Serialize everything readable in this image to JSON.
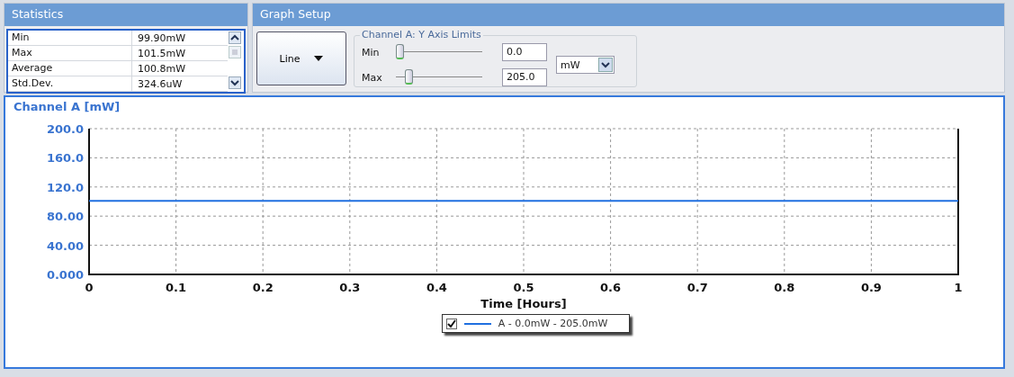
{
  "statistics": {
    "title": "Statistics",
    "rows": [
      {
        "label": "Min",
        "value": "99.90mW"
      },
      {
        "label": "Max",
        "value": "101.5mW"
      },
      {
        "label": "Average",
        "value": "100.8mW"
      },
      {
        "label": "Std.Dev.",
        "value": "324.6uW"
      }
    ]
  },
  "graph_setup": {
    "title": "Graph Setup",
    "type_button": "Line",
    "group_title": "Channel A: Y Axis Limits",
    "limits": [
      {
        "label": "Min",
        "level": 0.0,
        "value": "0.0"
      },
      {
        "label": "Max",
        "level": 0.12,
        "value": "205.0"
      }
    ],
    "unit": "mW"
  },
  "chart": {
    "title": "Channel A [mW]",
    "chart_data": {
      "type": "line",
      "xlabel": "Time [Hours]",
      "x": [
        0,
        1
      ],
      "series": [
        {
          "name": "A - 0.0mW - 205.0mW",
          "color": "#1f6fe0",
          "values": [
            101,
            101
          ]
        }
      ],
      "grid": true,
      "xlim": [
        0,
        1
      ],
      "ylim": [
        0,
        200
      ],
      "xticks": [
        0,
        0.1,
        0.2,
        0.3,
        0.4,
        0.5,
        0.6,
        0.7,
        0.8,
        0.9,
        1
      ],
      "yticks": [
        {
          "value": 0,
          "label": "0.000"
        },
        {
          "value": 40,
          "label": "40.00"
        },
        {
          "value": 80,
          "label": "80.00"
        },
        {
          "value": 120,
          "label": "120.0"
        },
        {
          "value": 160,
          "label": "160.0"
        },
        {
          "value": 200,
          "label": "200.0"
        }
      ]
    },
    "legend": {
      "checked": true
    }
  }
}
